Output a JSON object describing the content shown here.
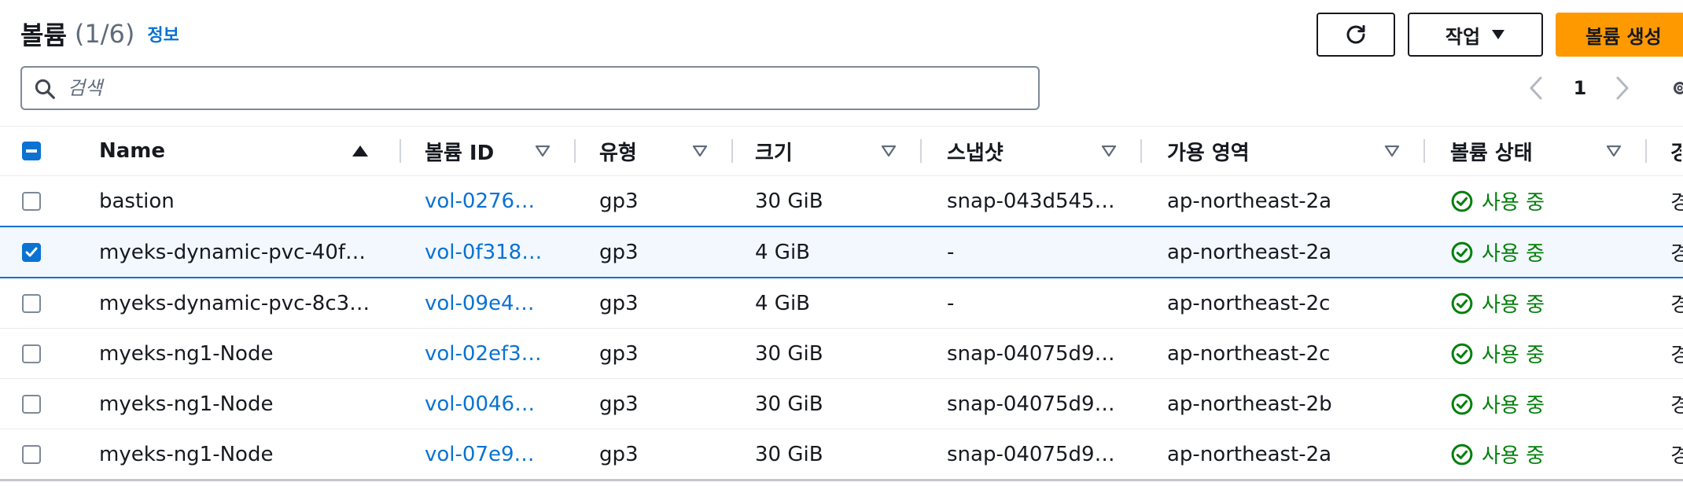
{
  "header": {
    "title": "볼륨",
    "count": "(1/6)",
    "info_link": "정보"
  },
  "toolbar": {
    "actions_label": "작업",
    "create_label": "볼륨 생성"
  },
  "search": {
    "placeholder": "검색",
    "value": ""
  },
  "pagination": {
    "current_page": "1"
  },
  "table": {
    "columns": [
      "Name",
      "볼륨 ID",
      "유형",
      "크기",
      "스냅샷",
      "가용 영역",
      "볼륨 상태",
      "경"
    ],
    "sorted_column": "Name",
    "sort_direction": "ascending",
    "rows": [
      {
        "selected": false,
        "name": "bastion",
        "volume_id": "vol-0276…",
        "type": "gp3",
        "size": "30 GiB",
        "snapshot": "snap-043d545…",
        "az": "ap-northeast-2a",
        "status": "사용 중",
        "extra": "경"
      },
      {
        "selected": true,
        "name": "myeks-dynamic-pvc-40f…",
        "volume_id": "vol-0f318…",
        "type": "gp3",
        "size": "4 GiB",
        "snapshot": "-",
        "az": "ap-northeast-2a",
        "status": "사용 중",
        "extra": "경"
      },
      {
        "selected": false,
        "name": "myeks-dynamic-pvc-8c3…",
        "volume_id": "vol-09e4…",
        "type": "gp3",
        "size": "4 GiB",
        "snapshot": "-",
        "az": "ap-northeast-2c",
        "status": "사용 중",
        "extra": "경"
      },
      {
        "selected": false,
        "name": "myeks-ng1-Node",
        "volume_id": "vol-02ef3…",
        "type": "gp3",
        "size": "30 GiB",
        "snapshot": "snap-04075d9…",
        "az": "ap-northeast-2c",
        "status": "사용 중",
        "extra": "경"
      },
      {
        "selected": false,
        "name": "myeks-ng1-Node",
        "volume_id": "vol-0046…",
        "type": "gp3",
        "size": "30 GiB",
        "snapshot": "snap-04075d9…",
        "az": "ap-northeast-2b",
        "status": "사용 중",
        "extra": "경"
      },
      {
        "selected": false,
        "name": "myeks-ng1-Node",
        "volume_id": "vol-07e9…",
        "type": "gp3",
        "size": "30 GiB",
        "snapshot": "snap-04075d9…",
        "az": "ap-northeast-2a",
        "status": "사용 중",
        "extra": "경"
      }
    ]
  },
  "colors": {
    "link": "#0972d3",
    "success": "#037f0c",
    "primary_button": "#ff9900",
    "selected_row_bg": "#f2f8fd"
  },
  "icons": {
    "refresh": "refresh-icon",
    "dropdown": "caret-down-icon",
    "search": "search-icon",
    "prev": "chevron-left-icon",
    "next": "chevron-right-icon",
    "settings": "gear-icon",
    "status": "check-circle-icon"
  }
}
